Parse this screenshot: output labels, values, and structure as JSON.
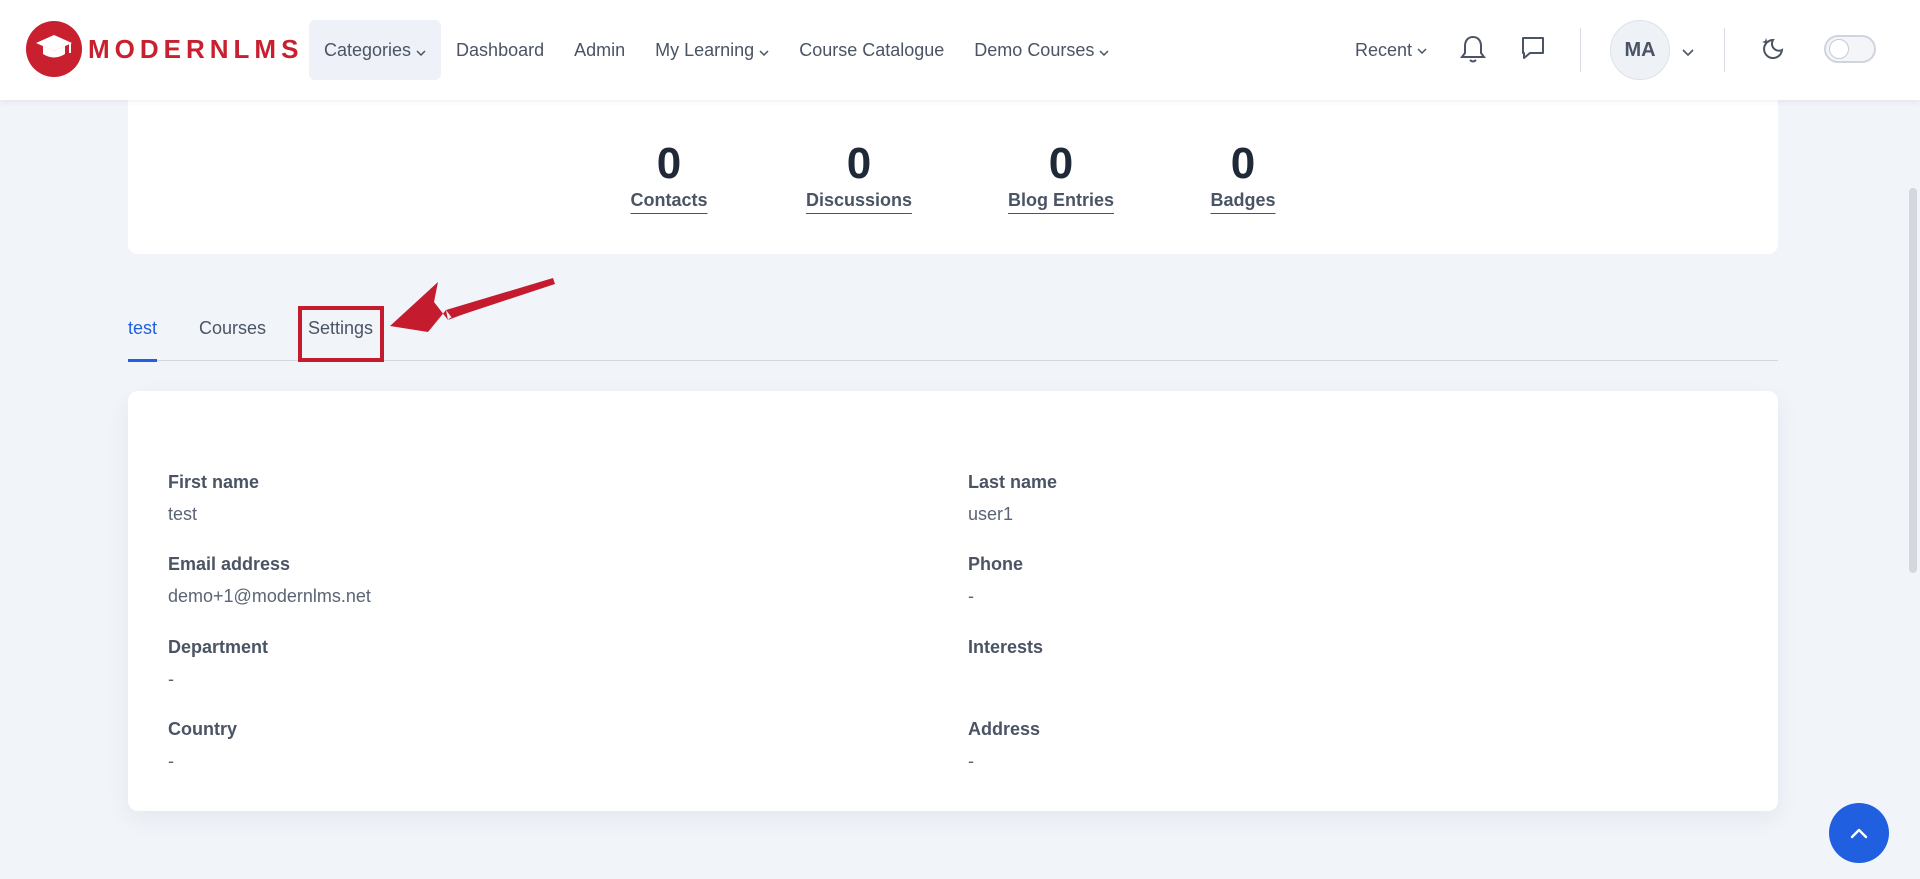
{
  "header": {
    "logo_text": "MODERNLMS",
    "nav": [
      {
        "label": "Categories",
        "has_dropdown": true,
        "active": true
      },
      {
        "label": "Dashboard",
        "has_dropdown": false
      },
      {
        "label": "Admin",
        "has_dropdown": false
      },
      {
        "label": "My Learning",
        "has_dropdown": true
      },
      {
        "label": "Course Catalogue",
        "has_dropdown": false
      },
      {
        "label": "Demo Courses",
        "has_dropdown": true
      }
    ],
    "recent_label": "Recent",
    "avatar_initials": "MA",
    "icons": [
      "bell-icon",
      "chat-icon",
      "chevron-down-icon",
      "moon-sparkle-icon"
    ]
  },
  "stats": [
    {
      "value": "0",
      "label": "Contacts"
    },
    {
      "value": "0",
      "label": "Discussions"
    },
    {
      "value": "0",
      "label": "Blog Entries"
    },
    {
      "value": "0",
      "label": "Badges"
    }
  ],
  "tabs": [
    {
      "label": "test",
      "active": true
    },
    {
      "label": "Courses",
      "active": false
    },
    {
      "label": "Settings",
      "active": false,
      "highlighted": true
    }
  ],
  "profile": {
    "first_name": {
      "label": "First name",
      "value": "test"
    },
    "last_name": {
      "label": "Last name",
      "value": "user1"
    },
    "email": {
      "label": "Email address",
      "value": "demo+1@modernlms.net"
    },
    "phone": {
      "label": "Phone",
      "value": "-"
    },
    "department": {
      "label": "Department",
      "value": "-"
    },
    "interests": {
      "label": "Interests",
      "value": ""
    },
    "country": {
      "label": "Country",
      "value": "-"
    },
    "address": {
      "label": "Address",
      "value": "-"
    }
  },
  "colors": {
    "brand_red": "#c8202f",
    "accent_blue": "#1f5fe0",
    "annotation_red": "#c41c2e",
    "page_bg": "#f1f4f9"
  }
}
